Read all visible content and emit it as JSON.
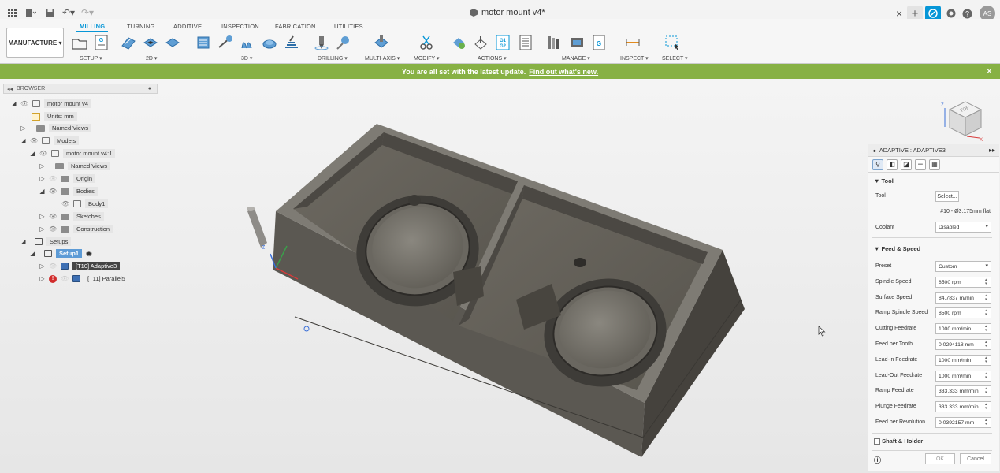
{
  "title_bar": {
    "document_name": "motor mount v4*",
    "user_initials": "AS"
  },
  "ribbon": {
    "workspace": "MANUFACTURE",
    "tabs": [
      "MILLING",
      "TURNING",
      "ADDITIVE",
      "INSPECTION",
      "FABRICATION",
      "UTILITIES"
    ],
    "active_tab": "MILLING",
    "groups": [
      "SETUP",
      "2D",
      "3D",
      "DRILLING",
      "MULTI-AXIS",
      "MODIFY",
      "ACTIONS",
      "MANAGE",
      "INSPECT",
      "SELECT"
    ]
  },
  "update_bar": {
    "message": "You are all set with the latest update.",
    "link": "Find out what's new."
  },
  "browser": {
    "header": "BROWSER",
    "tree": {
      "root": "motor mount v4",
      "units": "Units: mm",
      "named_views": "Named Views",
      "models": "Models",
      "model_component": "motor mount v4:1",
      "comp_named_views": "Named Views",
      "origin": "Origin",
      "bodies": "Bodies",
      "body1": "Body1",
      "sketches": "Sketches",
      "construction": "Construction",
      "setups": "Setups",
      "setup1": "Setup1",
      "op1": "[T10] Adaptive3",
      "op2": "[T11] Parallel5"
    }
  },
  "viewcube": {
    "face": "TOP",
    "axis_x": "X",
    "axis_z": "Z"
  },
  "axes_triad": {
    "z": "Z"
  },
  "panel": {
    "title": "ADAPTIVE : ADAPTIVE3",
    "tool_section": "Tool",
    "tool_label": "Tool",
    "tool_button": "Select...",
    "tool_desc": "#10 - Ø3.175mm flat",
    "coolant_label": "Coolant",
    "coolant_value": "Disabled",
    "feed_section": "Feed & Speed",
    "fields": [
      {
        "label": "Preset",
        "value": "Custom"
      },
      {
        "label": "Spindle Speed",
        "value": "8500 rpm"
      },
      {
        "label": "Surface Speed",
        "value": "84.7837 m/min"
      },
      {
        "label": "Ramp Spindle Speed",
        "value": "8500 rpm"
      },
      {
        "label": "Cutting Feedrate",
        "value": "1000 mm/min"
      },
      {
        "label": "Feed per Tooth",
        "value": "0.0294118 mm"
      },
      {
        "label": "Lead-in Feedrate",
        "value": "1000 mm/min"
      },
      {
        "label": "Lead-Out Feedrate",
        "value": "1000 mm/min"
      },
      {
        "label": "Ramp Feedrate",
        "value": "333.333 mm/min"
      },
      {
        "label": "Plunge Feedrate",
        "value": "333.333 mm/min"
      },
      {
        "label": "Feed per Revolution",
        "value": "0.0392157 mm"
      }
    ],
    "shaft_section": "Shaft & Holder",
    "ok": "OK",
    "cancel": "Cancel"
  }
}
